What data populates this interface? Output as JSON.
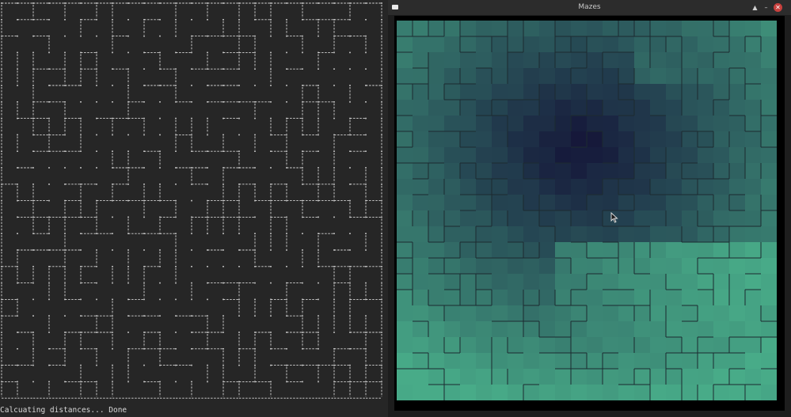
{
  "terminal": {
    "status_text": "Calcuating distances... Done",
    "bg_color": "#262626",
    "fg_color": "#d8d8d8"
  },
  "window": {
    "title": "Mazes",
    "icons": [
      "app-icon",
      "restore-icon",
      "minimize-icon",
      "close-icon"
    ],
    "close_color": "#c8413e"
  },
  "maze": {
    "rows": 24,
    "cols": 24,
    "near_color": "#141438",
    "far_color": "#48ab88",
    "wall_color": "#1c2a30"
  }
}
